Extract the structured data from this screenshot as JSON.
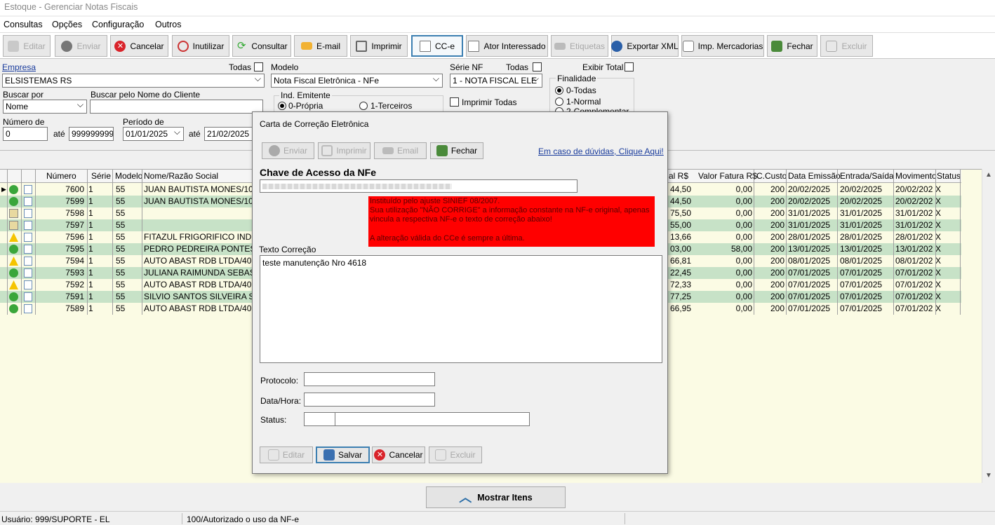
{
  "window": {
    "title": "Estoque - Gerenciar Notas Fiscais"
  },
  "menu": [
    "Consultas",
    "Opções",
    "Configuração",
    "Outros"
  ],
  "toolbar": {
    "editar": "Editar",
    "enviar": "Enviar",
    "cancelar": "Cancelar",
    "inutilizar": "Inutilizar",
    "consultar": "Consultar",
    "email": "E-mail",
    "imprimir": "Imprimir",
    "cce": "CC-e",
    "ator": "Ator Interessado",
    "etiquetas": "Etiquetas",
    "exportar": "Exportar XML",
    "impmerc": "Imp. Mercadorias",
    "fechar": "Fechar",
    "excluir": "Excluir"
  },
  "filters": {
    "empresa_label": "Empresa",
    "todas1": "Todas",
    "empresa_value": "ELSISTEMAS RS",
    "modelo_label": "Modelo",
    "modelo_value": "Nota Fiscal Eletrônica - NFe",
    "serie_label": "Série NF",
    "todas2": "Todas",
    "serie_value": "1 - NOTA FISCAL ELE",
    "exibir_total": "Exibir Total",
    "buscar_por_label": "Buscar por",
    "buscar_por_value": "Nome",
    "buscar_nome_label": "Buscar pelo Nome do Cliente",
    "buscar_nome_value": "",
    "ind_emitente": "Ind. Emitente",
    "propria": "0-Própria",
    "terceiros": "1-Terceiros",
    "imprimir_todas": "Imprimir Todas",
    "finalidade": "Finalidade",
    "fin0": "0-Todas",
    "fin1": "1-Normal",
    "fin2": "2-Complementar",
    "numero_label": "Número de",
    "numero_de": "0",
    "ate1": "até",
    "numero_ate": "999999999",
    "periodo_label": "Período de",
    "periodo_de": "01/01/2025",
    "ate2": "até",
    "periodo_ate": "21/02/2025"
  },
  "grid": {
    "headers": [
      "Número",
      "Série",
      "Modelo",
      "Nome/Razão Social",
      "al R$",
      "Valor Fatura R$",
      "C.Custo",
      "Data Emissão",
      "Entrada/Saída",
      "Movimento",
      "Status"
    ],
    "rows": [
      {
        "num": "7600",
        "serie": "1",
        "modelo": "55",
        "nome": "JUAN BAUTISTA MONES/10",
        "total": "44,50",
        "fatura": "0,00",
        "ccusto": "200",
        "emissao": "20/02/2025",
        "entrada": "20/02/2025",
        "mov": "20/02/202",
        "status": "X",
        "icon": "ok"
      },
      {
        "num": "7599",
        "serie": "1",
        "modelo": "55",
        "nome": "JUAN BAUTISTA MONES/10",
        "total": "44,50",
        "fatura": "0,00",
        "ccusto": "200",
        "emissao": "20/02/2025",
        "entrada": "20/02/2025",
        "mov": "20/02/202",
        "status": "X",
        "icon": "ok"
      },
      {
        "num": "7598",
        "serie": "1",
        "modelo": "55",
        "nome": "",
        "total": "75,50",
        "fatura": "0,00",
        "ccusto": "200",
        "emissao": "31/01/2025",
        "entrada": "31/01/2025",
        "mov": "31/01/202",
        "status": "X",
        "icon": "edit"
      },
      {
        "num": "7597",
        "serie": "1",
        "modelo": "55",
        "nome": "",
        "total": "55,00",
        "fatura": "0,00",
        "ccusto": "200",
        "emissao": "31/01/2025",
        "entrada": "31/01/2025",
        "mov": "31/01/202",
        "status": "X",
        "icon": "edit"
      },
      {
        "num": "7596",
        "serie": "1",
        "modelo": "55",
        "nome": "FITAZUL FRIGORIFICO INDU",
        "total": "13,66",
        "fatura": "0,00",
        "ccusto": "200",
        "emissao": "28/01/2025",
        "entrada": "28/01/2025",
        "mov": "28/01/202",
        "status": "X",
        "icon": "warn"
      },
      {
        "num": "7595",
        "serie": "1",
        "modelo": "55",
        "nome": "PEDRO PEDREIRA PONTES/",
        "total": "03,00",
        "fatura": "58,00",
        "ccusto": "200",
        "emissao": "13/01/2025",
        "entrada": "13/01/2025",
        "mov": "13/01/202",
        "status": "X",
        "icon": "ok"
      },
      {
        "num": "7594",
        "serie": "1",
        "modelo": "55",
        "nome": "AUTO ABAST RDB LTDA/40",
        "total": "66,81",
        "fatura": "0,00",
        "ccusto": "200",
        "emissao": "08/01/2025",
        "entrada": "08/01/2025",
        "mov": "08/01/202",
        "status": "X",
        "icon": "warn"
      },
      {
        "num": "7593",
        "serie": "1",
        "modelo": "55",
        "nome": "JULIANA RAIMUNDA SEBAS",
        "total": "22,45",
        "fatura": "0,00",
        "ccusto": "200",
        "emissao": "07/01/2025",
        "entrada": "07/01/2025",
        "mov": "07/01/202",
        "status": "X",
        "icon": "ok"
      },
      {
        "num": "7592",
        "serie": "1",
        "modelo": "55",
        "nome": "AUTO ABAST RDB LTDA/40",
        "total": "72,33",
        "fatura": "0,00",
        "ccusto": "200",
        "emissao": "07/01/2025",
        "entrada": "07/01/2025",
        "mov": "07/01/202",
        "status": "X",
        "icon": "warn"
      },
      {
        "num": "7591",
        "serie": "1",
        "modelo": "55",
        "nome": "SILVIO SANTOS SILVEIRA SA",
        "total": "77,25",
        "fatura": "0,00",
        "ccusto": "200",
        "emissao": "07/01/2025",
        "entrada": "07/01/2025",
        "mov": "07/01/202",
        "status": "X",
        "icon": "ok"
      },
      {
        "num": "7589",
        "serie": "1",
        "modelo": "55",
        "nome": "AUTO ABAST RDB LTDA/40",
        "total": "66,95",
        "fatura": "0,00",
        "ccusto": "200",
        "emissao": "07/01/2025",
        "entrada": "07/01/2025",
        "mov": "07/01/202",
        "status": "X",
        "icon": "ok"
      }
    ]
  },
  "dialog": {
    "title": "Carta de Correção Eletrônica",
    "enviar": "Enviar",
    "imprimir": "Imprimir",
    "email": "Email",
    "fechar": "Fechar",
    "duvidas": "Em caso de dúvidas, Clique Aqui!",
    "chave_label": "Chave de Acesso da NFe",
    "aviso1": "Instituído pelo ajuste SINIEF 08/2007.",
    "aviso2": "Sua utilização \"NÃO CORRIGE\" a informação constante na NF-e original, apenas vincula a respectiva NF-e o texto de correção abaixo!",
    "aviso3": "A alteração válida do CCe é sempre a última.",
    "texto_label": "Texto Correção",
    "texto_value": "teste manutenção Nro 4618",
    "protocolo_label": "Protocolo:",
    "datahora_label": "Data/Hora:",
    "status_label": "Status:",
    "btn_editar": "Editar",
    "btn_salvar": "Salvar",
    "btn_cancelar": "Cancelar",
    "btn_excluir": "Excluir"
  },
  "mostrar_itens": "Mostrar Itens",
  "statusbar": {
    "usuario": "Usuário: 999/SUPORTE - EL",
    "mensagem": "100/Autorizado o uso da NF-e"
  },
  "colors": {
    "row_alt": "#c7e2c7",
    "grid_bg": "#fbfbe4",
    "alert": "#ff0000",
    "accent": "#3c7fb1"
  }
}
